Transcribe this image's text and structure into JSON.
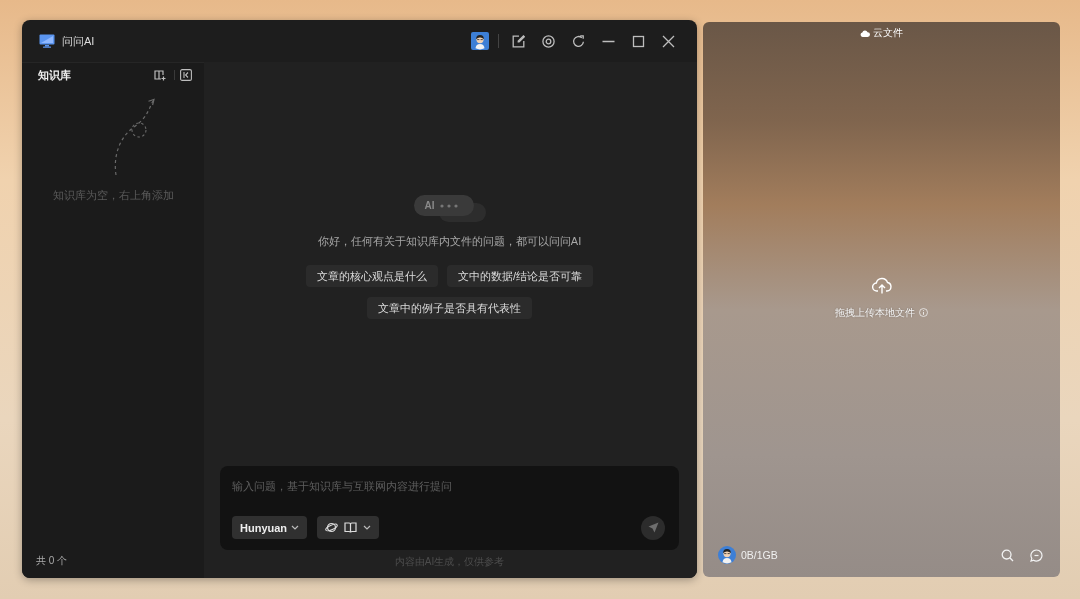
{
  "window": {
    "title": "问问AI"
  },
  "sidebar": {
    "title": "知识库",
    "empty_text": "知识库为空，右上角添加",
    "count": "共 0 个"
  },
  "chat": {
    "bubble_label": "AI",
    "greeting": "你好，任何有关于知识库内文件的问题，都可以问问AI",
    "suggestions": [
      "文章的核心观点是什么",
      "文中的数据/结论是否可靠",
      "文章中的例子是否具有代表性"
    ],
    "input": {
      "placeholder": "输入问题，基于知识库与互联网内容进行提问"
    },
    "model": "Hunyuan",
    "disclaimer": "内容由AI生成，仅供参考"
  },
  "cloud_panel": {
    "title": "云文件",
    "upload_hint": "拖拽上传本地文件",
    "storage": "0B/1GB"
  }
}
